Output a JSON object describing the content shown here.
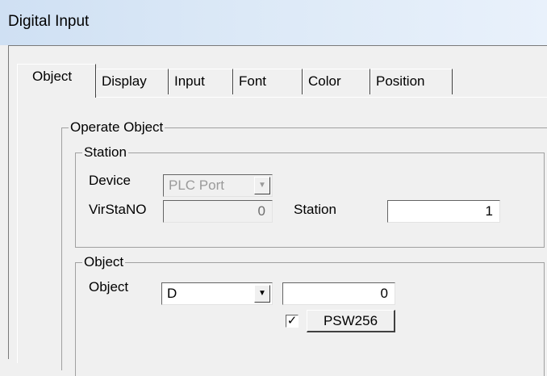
{
  "window": {
    "title": "Digital Input"
  },
  "tabs": [
    {
      "label": "Object",
      "active": true
    },
    {
      "label": "Display",
      "active": false
    },
    {
      "label": "Input",
      "active": false
    },
    {
      "label": "Font",
      "active": false
    },
    {
      "label": "Color",
      "active": false
    },
    {
      "label": "Position",
      "active": false
    }
  ],
  "operate_object": {
    "legend": "Operate Object",
    "station": {
      "legend": "Station",
      "device_label": "Device",
      "device_value": "PLC Port",
      "virsta_label": "VirStaNO",
      "virsta_value": "0",
      "station_label": "Station",
      "station_value": "1"
    },
    "object": {
      "legend": "Object",
      "object_label": "Object",
      "type_value": "D",
      "address_value": "0",
      "checkbox_checked": true,
      "psw_button_label": "PSW256"
    }
  },
  "icons": {
    "dropdown": "chevron-down-icon",
    "check": "check-icon"
  }
}
